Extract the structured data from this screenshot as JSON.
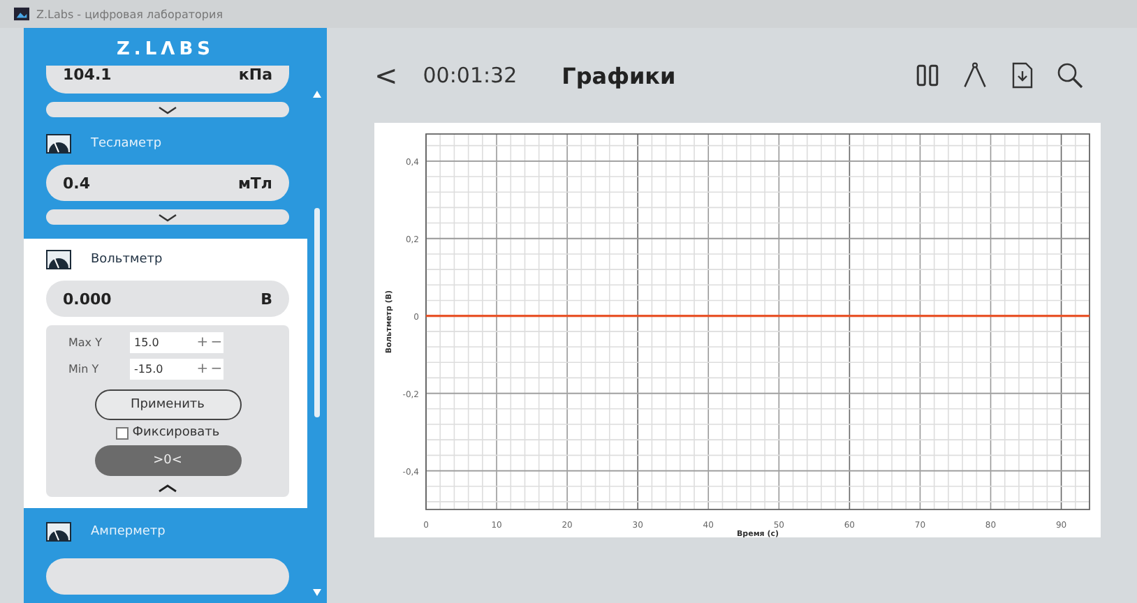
{
  "window": {
    "title": "Z.Labs - цифровая лаборатория"
  },
  "sidebar": {
    "logo": "Z.LΛBS",
    "sensors": [
      {
        "kind": "value_only",
        "value": "104.1",
        "unit": "кПа",
        "expanded": false
      },
      {
        "kind": "sensor",
        "name": "Тесламетр",
        "value": "0.4",
        "unit": "мТл",
        "expanded": false
      },
      {
        "kind": "sensor",
        "name": "Вольтметр",
        "value": "0.000",
        "unit": "В",
        "expanded": true,
        "settings": {
          "rows": [
            {
              "label": "Max Y",
              "value": "15.0",
              "plus": "+",
              "minus": "−"
            },
            {
              "label": "Min Y",
              "value": "-15.0",
              "plus": "+",
              "minus": "−"
            }
          ],
          "apply": "Применить",
          "fix": {
            "label": "Фиксировать",
            "checked": false
          },
          "zero": ">0<"
        }
      },
      {
        "kind": "name_only",
        "name": "Амперметр",
        "expanded": false
      }
    ]
  },
  "header": {
    "back": "<",
    "time": "00:01:32",
    "title": "Графики"
  },
  "chart_data": {
    "type": "line",
    "xlabel": "Время (с)",
    "ylabel": "Вольтметр (В)",
    "x": [
      0,
      94
    ],
    "xlim": [
      0,
      94
    ],
    "ylim": [
      -0.5,
      0.47
    ],
    "xticks": [
      0,
      10,
      20,
      30,
      40,
      50,
      60,
      70,
      80,
      90
    ],
    "yticks": [
      {
        "value": -0.4,
        "label": "-0,4"
      },
      {
        "value": -0.2,
        "label": "-0,2"
      },
      {
        "value": 0,
        "label": "0"
      },
      {
        "value": 0.2,
        "label": "0,2"
      },
      {
        "value": 0.4,
        "label": "0,4"
      }
    ],
    "grid": true,
    "series": [
      {
        "color": "#e8542a",
        "values": [
          0,
          0
        ]
      }
    ]
  }
}
